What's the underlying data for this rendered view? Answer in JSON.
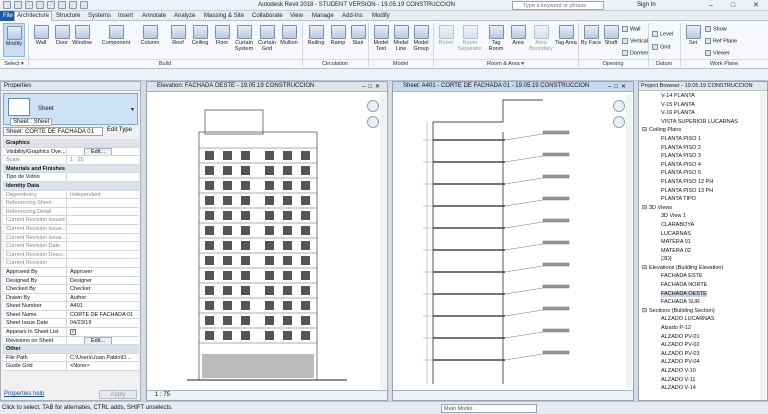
{
  "app": {
    "title": "Autodesk Revit 2018 - STUDENT VERSION -    19.05.19 CONSTRUCCION"
  },
  "search": {
    "placeholder": "Type a keyword or phrase"
  },
  "account": {
    "signin": "Sign In"
  },
  "tabs": [
    "File",
    "Architecture",
    "Structure",
    "Systems",
    "Insert",
    "Annotate",
    "Analyze",
    "Massing & Site",
    "Collaborate",
    "View",
    "Manage",
    "Add-Ins",
    "Modify"
  ],
  "ribbon": {
    "tools": [
      "Modify",
      "Wall",
      "Door",
      "Window",
      "Component",
      "Column",
      "Roof",
      "Ceiling",
      "Floor",
      "Curtain System",
      "Curtain Grid",
      "Mullion",
      "Railing",
      "Ramp",
      "Stair",
      "Model Text",
      "Model Line",
      "Model Group",
      "Room",
      "Room Separator",
      "Tag Room",
      "Area",
      "Area Boundary",
      "Tag Area",
      "By Face",
      "Shaft",
      "Set"
    ],
    "mini": [
      "Wall",
      "Vertical",
      "Dormer",
      "Level",
      "Grid",
      "Show",
      "Ref Plane",
      "Viewer"
    ],
    "groups": [
      "Select ▾",
      "Build",
      "Circulation",
      "Model",
      "Room & Area ▾",
      "Opening",
      "Datum",
      "Work Plane"
    ]
  },
  "properties": {
    "title": "Properties",
    "type_name": "Sheet",
    "type_label": "Sheet : Sheet",
    "selector": "Sheet: CORTE DE FACHADA 01",
    "edit_type": "Edit Type",
    "rows": [
      {
        "h": "Graphics"
      },
      {
        "k": "Visibility/Graphics Ove...",
        "v": "Edit..."
      },
      {
        "k": "Scale",
        "v": "1 : 25",
        "ro": true
      },
      {
        "h": "Materials and Finishes"
      },
      {
        "k": "Tipo de Vidrio",
        "v": ""
      },
      {
        "h": "Identity Data"
      },
      {
        "k": "Dependency",
        "v": "Independent",
        "ro": true
      },
      {
        "k": "Referencing Sheet",
        "v": "",
        "ro": true
      },
      {
        "k": "Referencing Detail",
        "v": "",
        "ro": true
      },
      {
        "k": "Current Revision Issued",
        "v": "",
        "ro": true
      },
      {
        "k": "Current Revision Issue...",
        "v": "",
        "ro": true
      },
      {
        "k": "Current Revision Issue...",
        "v": "",
        "ro": true
      },
      {
        "k": "Current Revision Date",
        "v": "",
        "ro": true
      },
      {
        "k": "Current Revision Descr...",
        "v": "",
        "ro": true
      },
      {
        "k": "Current Revision",
        "v": "",
        "ro": true
      },
      {
        "k": "Approved By",
        "v": "Approver"
      },
      {
        "k": "Designed By",
        "v": "Designer"
      },
      {
        "k": "Checked By",
        "v": "Checker"
      },
      {
        "k": "Drawn By",
        "v": "Author"
      },
      {
        "k": "Sheet Number",
        "v": "A401"
      },
      {
        "k": "Sheet Name",
        "v": "CORTE DE FACHADA 01"
      },
      {
        "k": "Sheet Issue Date",
        "v": "04/23/19"
      },
      {
        "k": "Appears In Sheet List",
        "v": "✓"
      },
      {
        "k": "Revisions on Sheet",
        "v": "Edit..."
      },
      {
        "h": "Other"
      },
      {
        "k": "File Path",
        "v": "C:\\Users\\Juan Pablo\\D..."
      },
      {
        "k": "Guide Grid",
        "v": "<None>"
      }
    ],
    "help": "Properties help",
    "apply": "Apply"
  },
  "views": {
    "left": {
      "title": "Elevation: FACHADA OESTE - 19.05.19 CONSTRUCCION",
      "scale": "1 : 75"
    },
    "right": {
      "title": "Sheet: A401 - CORTE DE FACHADA 01 - 19.05.19 CONSTRUCCION"
    }
  },
  "browser": {
    "title": "Project Browser - 19.05.19 CONSTRUCCION",
    "items": [
      {
        "t": "V-14 PLANTA",
        "c": 1
      },
      {
        "t": "V-15 PLANTA",
        "c": 1
      },
      {
        "t": "V-16 PLANTA",
        "c": 1
      },
      {
        "t": "VISTA SUPERIOR LUCARNAS",
        "c": 1
      },
      {
        "t": "Ceiling Plans",
        "c": 0
      },
      {
        "t": "PLANTA PISO 1",
        "c": 1
      },
      {
        "t": "PLANTA PISO 2",
        "c": 1
      },
      {
        "t": "PLANTA PISO 3",
        "c": 1
      },
      {
        "t": "PLANTA PISO 4",
        "c": 1
      },
      {
        "t": "PLANTA PISO 5",
        "c": 1
      },
      {
        "t": "PLANTA PISO 12  PH",
        "c": 1
      },
      {
        "t": "PLANTA PISO 13 PH",
        "c": 1
      },
      {
        "t": "PLANTA TIPO",
        "c": 1
      },
      {
        "t": "3D Views",
        "c": 0
      },
      {
        "t": "3D View 1",
        "c": 1
      },
      {
        "t": "CLARABOYA",
        "c": 1
      },
      {
        "t": "LUCARNAS",
        "c": 1
      },
      {
        "t": "MATERA 01",
        "c": 1
      },
      {
        "t": "MATERA 02",
        "c": 1
      },
      {
        "t": "{3D}",
        "c": 1
      },
      {
        "t": "Elevations (Building Elevation)",
        "c": 0
      },
      {
        "t": "FACHADA ESTE",
        "c": 1
      },
      {
        "t": "FACHADA NORTE",
        "c": 1
      },
      {
        "t": "FACHADA OESTE",
        "c": 1,
        "sel": true
      },
      {
        "t": "FACHADA SUR",
        "c": 1
      },
      {
        "t": "Sections (Building Section)",
        "c": 0
      },
      {
        "t": "ALZADO LUCARNAS",
        "c": 1
      },
      {
        "t": "Alzado P-12",
        "c": 1
      },
      {
        "t": "ALZADO PV-01",
        "c": 1
      },
      {
        "t": "ALZADO PV-02",
        "c": 1
      },
      {
        "t": "ALZADO PV-03",
        "c": 1
      },
      {
        "t": "ALZADO PV-04",
        "c": 1
      },
      {
        "t": "ALZADO V-10",
        "c": 1
      },
      {
        "t": "ALZADO V-11",
        "c": 1
      },
      {
        "t": "ALZADO V-14",
        "c": 1
      }
    ]
  },
  "status": {
    "text": "Click to select, TAB for alternates, CTRL adds, SHIFT unselects.",
    "model": "Main Model"
  }
}
